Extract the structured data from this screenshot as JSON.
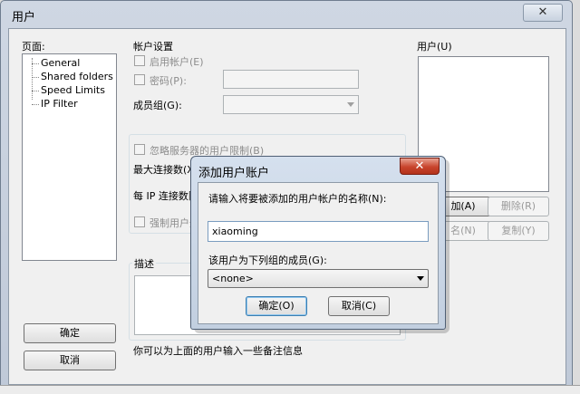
{
  "window": {
    "title": "用户",
    "close_glyph": "✕"
  },
  "pages": {
    "label": "页面:",
    "items": [
      "General",
      "Shared folders",
      "Speed Limits",
      "IP Filter"
    ]
  },
  "account": {
    "group_label": "帐户设置",
    "enable_account": "启用帐户(E)",
    "password": "密码(P):",
    "member_group": "成员组(G):"
  },
  "limits": {
    "ignore_server_limits": "忽略服务器的用户限制(B)",
    "max_connections": "最大连接数(X",
    "per_ip": "每 IP 连接数限",
    "force_ssl": "强制用户登"
  },
  "description": {
    "group_label": "描述",
    "hint": "你可以为上面的用户输入一些备注信息"
  },
  "users": {
    "label": "用户(U)",
    "add_button": "加(A)",
    "delete_button": "删除(R)",
    "rename_button": "名(N)",
    "copy_button": "复制(Y)"
  },
  "main_buttons": {
    "ok": "确定",
    "cancel": "取消"
  },
  "modal": {
    "title": "添加用户账户",
    "close_glyph": "✕",
    "name_prompt": "请输入将要被添加的用户帐户的名称(N):",
    "name_value": "xiaoming",
    "group_prompt": "该用户为下列组的成员(G):",
    "group_value": "<none>",
    "ok_button": "确定(O)",
    "cancel_button": "取消(C)"
  }
}
